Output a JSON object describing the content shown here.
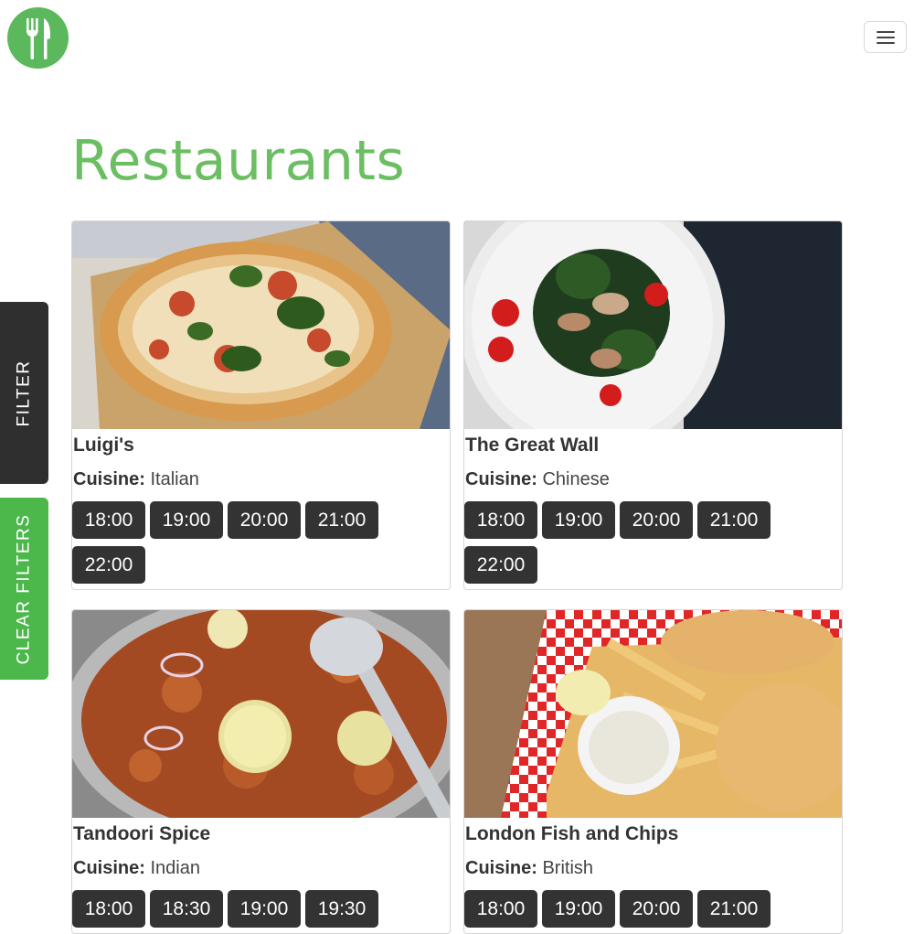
{
  "header": {
    "logo_icon": "fork-knife-icon",
    "menu_icon": "hamburger-menu-icon",
    "brand_color": "#5cb85c"
  },
  "page": {
    "title": "Restaurants"
  },
  "side_tabs": {
    "filter": "FILTER",
    "clear": "CLEAR FILTERS"
  },
  "cuisine_label": "Cuisine:",
  "restaurants": [
    {
      "name": "Luigi's",
      "cuisine": "Italian",
      "image": "pizza",
      "times": [
        "18:00",
        "19:00",
        "20:00",
        "21:00",
        "22:00"
      ]
    },
    {
      "name": "The Great Wall",
      "cuisine": "Chinese",
      "image": "salad-plate",
      "times": [
        "18:00",
        "19:00",
        "20:00",
        "21:00",
        "22:00"
      ]
    },
    {
      "name": "Tandoori Spice",
      "cuisine": "Indian",
      "image": "curry",
      "times": [
        "18:00",
        "18:30",
        "19:00",
        "19:30"
      ]
    },
    {
      "name": "London Fish and Chips",
      "cuisine": "British",
      "image": "fish-and-chips",
      "times": [
        "18:00",
        "19:00",
        "20:00",
        "21:00"
      ]
    }
  ]
}
